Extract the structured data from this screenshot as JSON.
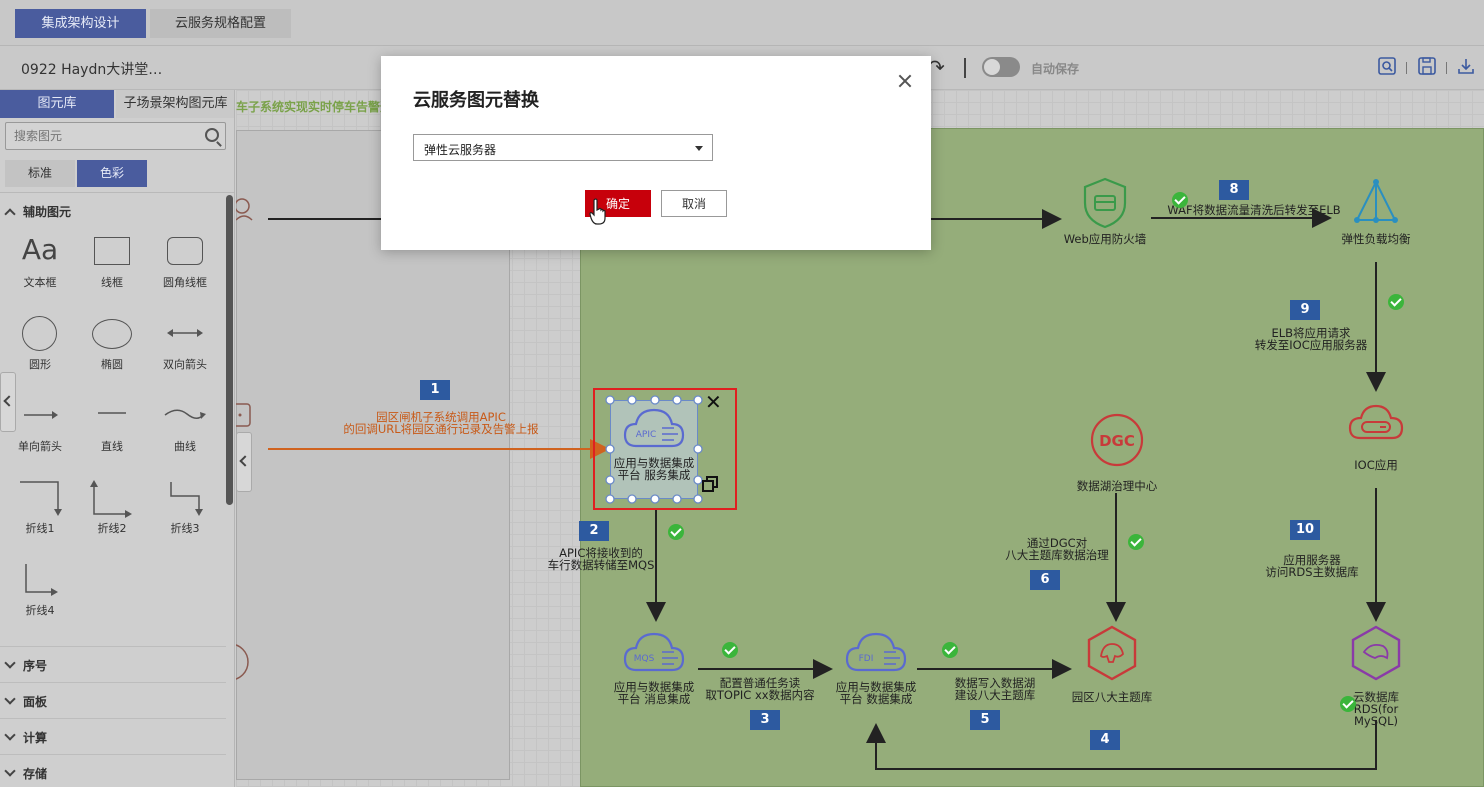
{
  "top_tabs": {
    "active": "集成架构设计",
    "inactive": "云服务规格配置"
  },
  "toolbar": {
    "doc_title": "0922 Haydn大讲堂…",
    "autosave": "自动保存"
  },
  "library": {
    "tab_active": "图元库",
    "tab_inactive": "子场景架构图元库",
    "search_placeholder": "搜索图元",
    "style_standard": "标准",
    "style_color": "色彩",
    "aux_section": "辅助图元",
    "shapes": [
      "文本框",
      "线框",
      "圆角线框",
      "圆形",
      "椭圆",
      "双向箭头",
      "单向箭头",
      "直线",
      "曲线",
      "折线1",
      "折线2",
      "折线3",
      "折线4"
    ],
    "text_glyph": "Aa",
    "sections": [
      "序号",
      "面板",
      "计算",
      "存储"
    ]
  },
  "canvas": {
    "note_top": "车子系统实现实时停车告警通",
    "nodes": {
      "waf": "Web应用防火墙",
      "elb": "弹性负载均衡",
      "ioc": "IOC应用",
      "dgc": "数据湖治理中心",
      "apic_1": "应用与数据集成",
      "apic_2": "平台 服务集成",
      "mqs_1": "应用与数据集成",
      "mqs_2": "平台 消息集成",
      "fdi_1": "应用与数据集成",
      "fdi_2": "平台 数据集成",
      "lake": "园区八大主题库",
      "rds_1": "云数据库",
      "rds_2": "RDS(for",
      "rds_3": "MySQL)"
    },
    "icon_text": {
      "apic": "APIC",
      "mqs": "MQS",
      "fdi": "FDI",
      "dgc": "DGC"
    },
    "steps": {
      "s1": "1",
      "s2": "2",
      "s3": "3",
      "s4": "4",
      "s5": "5",
      "s6": "6",
      "s8": "8",
      "s9": "9",
      "s10": "10"
    },
    "notes": {
      "n1_a": "园区闸机子系统调用APIC",
      "n1_b": "的回调URL将园区通行记录及告警上报",
      "n2_a": "APIC将接收到的",
      "n2_b": "车行数据转储至MQS",
      "n3_a": "配置普通任务读",
      "n3_b": "取TOPIC xx数据内容",
      "n5_a": "数据写入数据湖",
      "n5_b": "建设八大主题库",
      "n6_a": "通过DGC对",
      "n6_b": "八大主题库数据治理",
      "n8": "WAF将数据流量清洗后转发至ELB",
      "n9_a": "ELB将应用请求",
      "n9_b": "转发至IOC应用服务器",
      "n10_a": "应用服务器",
      "n10_b": "访问RDS主数据库"
    }
  },
  "dialog": {
    "title": "云服务图元替换",
    "select_value": "弹性云服务器",
    "ok": "确定",
    "cancel": "取消"
  },
  "colors": {
    "accent": "#4a5c9e",
    "ok_button": "#c7000b",
    "step_badge": "#2d5aa0",
    "green_region": "#95ad7a",
    "check": "#3bb53b"
  }
}
